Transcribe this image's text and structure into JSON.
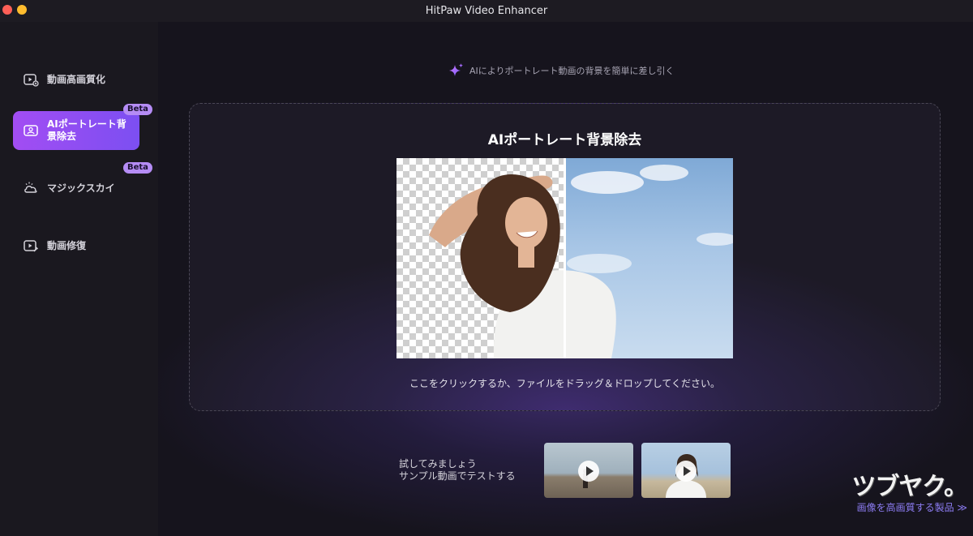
{
  "window": {
    "title": "HitPaw Video Enhancer"
  },
  "sidebar": {
    "items": [
      {
        "label": "動画高画質化",
        "icon": "video-enhance-icon",
        "active": false,
        "badge": ""
      },
      {
        "label_line1": "AIポートレート背",
        "label_line2": "景除去",
        "icon": "portrait-camera-icon",
        "active": true,
        "badge": "Beta"
      },
      {
        "label": "マジックスカイ",
        "icon": "cloud-sky-icon",
        "active": false,
        "badge": "Beta"
      },
      {
        "label": "動画修復",
        "icon": "video-repair-icon",
        "active": false,
        "badge": ""
      }
    ]
  },
  "main": {
    "tip": "AIによりポートレート動画の背景を簡単に差し引く",
    "tip_icon": "sparkle-icon",
    "dropzone": {
      "title": "AIポートレート背景除去",
      "hint": "ここをクリックするか、ファイルをドラッグ＆ドロップしてください。"
    },
    "samples": {
      "line1": "試してみましょう",
      "line2": "サンプル動画でテストする"
    }
  },
  "watermark": {
    "logo": "ツブヤク。",
    "link": "画像を高画質する製品 ≫"
  },
  "colors": {
    "accent_start": "#a24df3",
    "accent_end": "#7c4ff2",
    "badge": "#b58cf5",
    "link": "#8c7cf2"
  }
}
